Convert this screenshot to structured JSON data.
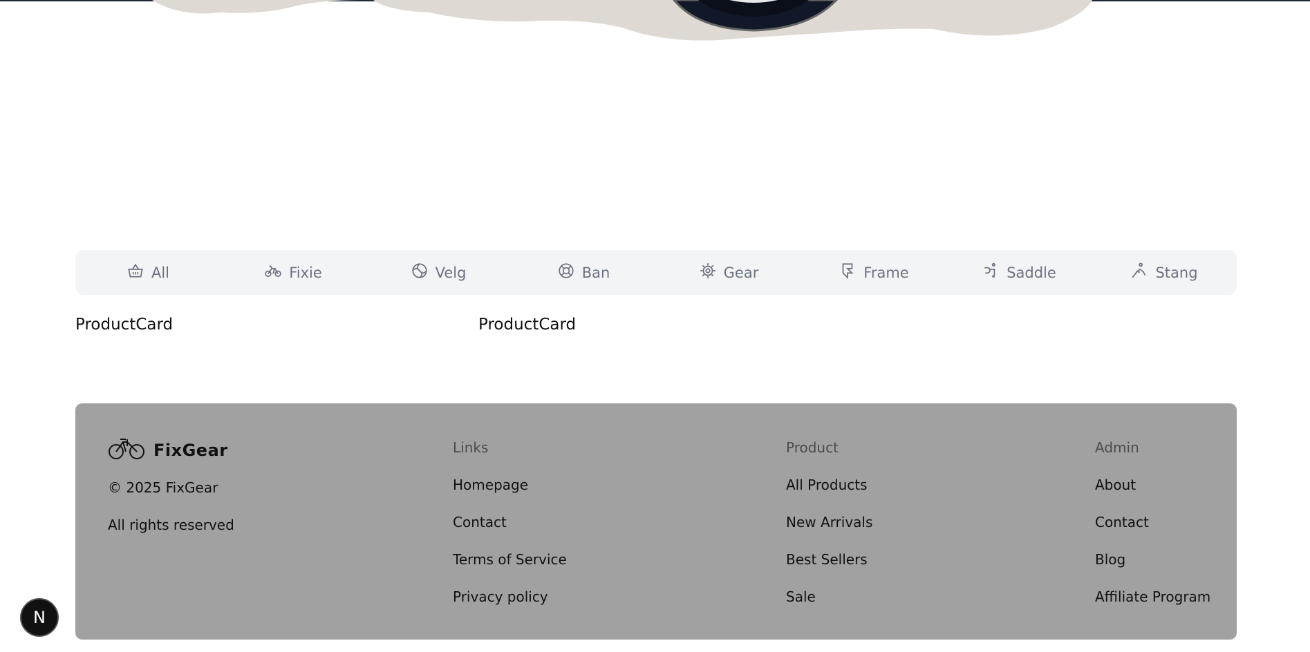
{
  "categories": [
    {
      "label": "All",
      "icon": "basket-icon"
    },
    {
      "label": "Fixie",
      "icon": "bike-icon"
    },
    {
      "label": "Velg",
      "icon": "wheel-icon"
    },
    {
      "label": "Ban",
      "icon": "tire-icon"
    },
    {
      "label": "Gear",
      "icon": "gear-icon"
    },
    {
      "label": "Frame",
      "icon": "frame-icon"
    },
    {
      "label": "Saddle",
      "icon": "saddle-icon"
    },
    {
      "label": "Stang",
      "icon": "handlebar-icon"
    }
  ],
  "products": [
    "ProductCard",
    "ProductCard"
  ],
  "footer": {
    "brand": "FixGear",
    "copyright": "© 2025 FixGear",
    "rights": "All rights reserved",
    "columns": [
      {
        "title": "Links",
        "links": [
          "Homepage",
          "Contact",
          "Terms of Service",
          "Privacy policy"
        ]
      },
      {
        "title": "Product",
        "links": [
          "All Products",
          "New Arrivals",
          "Best Sellers",
          "Sale"
        ]
      },
      {
        "title": "Admin",
        "links": [
          "About",
          "Contact",
          "Blog",
          "Affiliate Program"
        ]
      }
    ]
  },
  "badge": "N",
  "colors": {
    "footer_bg": "#a1a1a1",
    "category_bar_bg": "#f3f4f6",
    "category_text": "#6b7280"
  }
}
